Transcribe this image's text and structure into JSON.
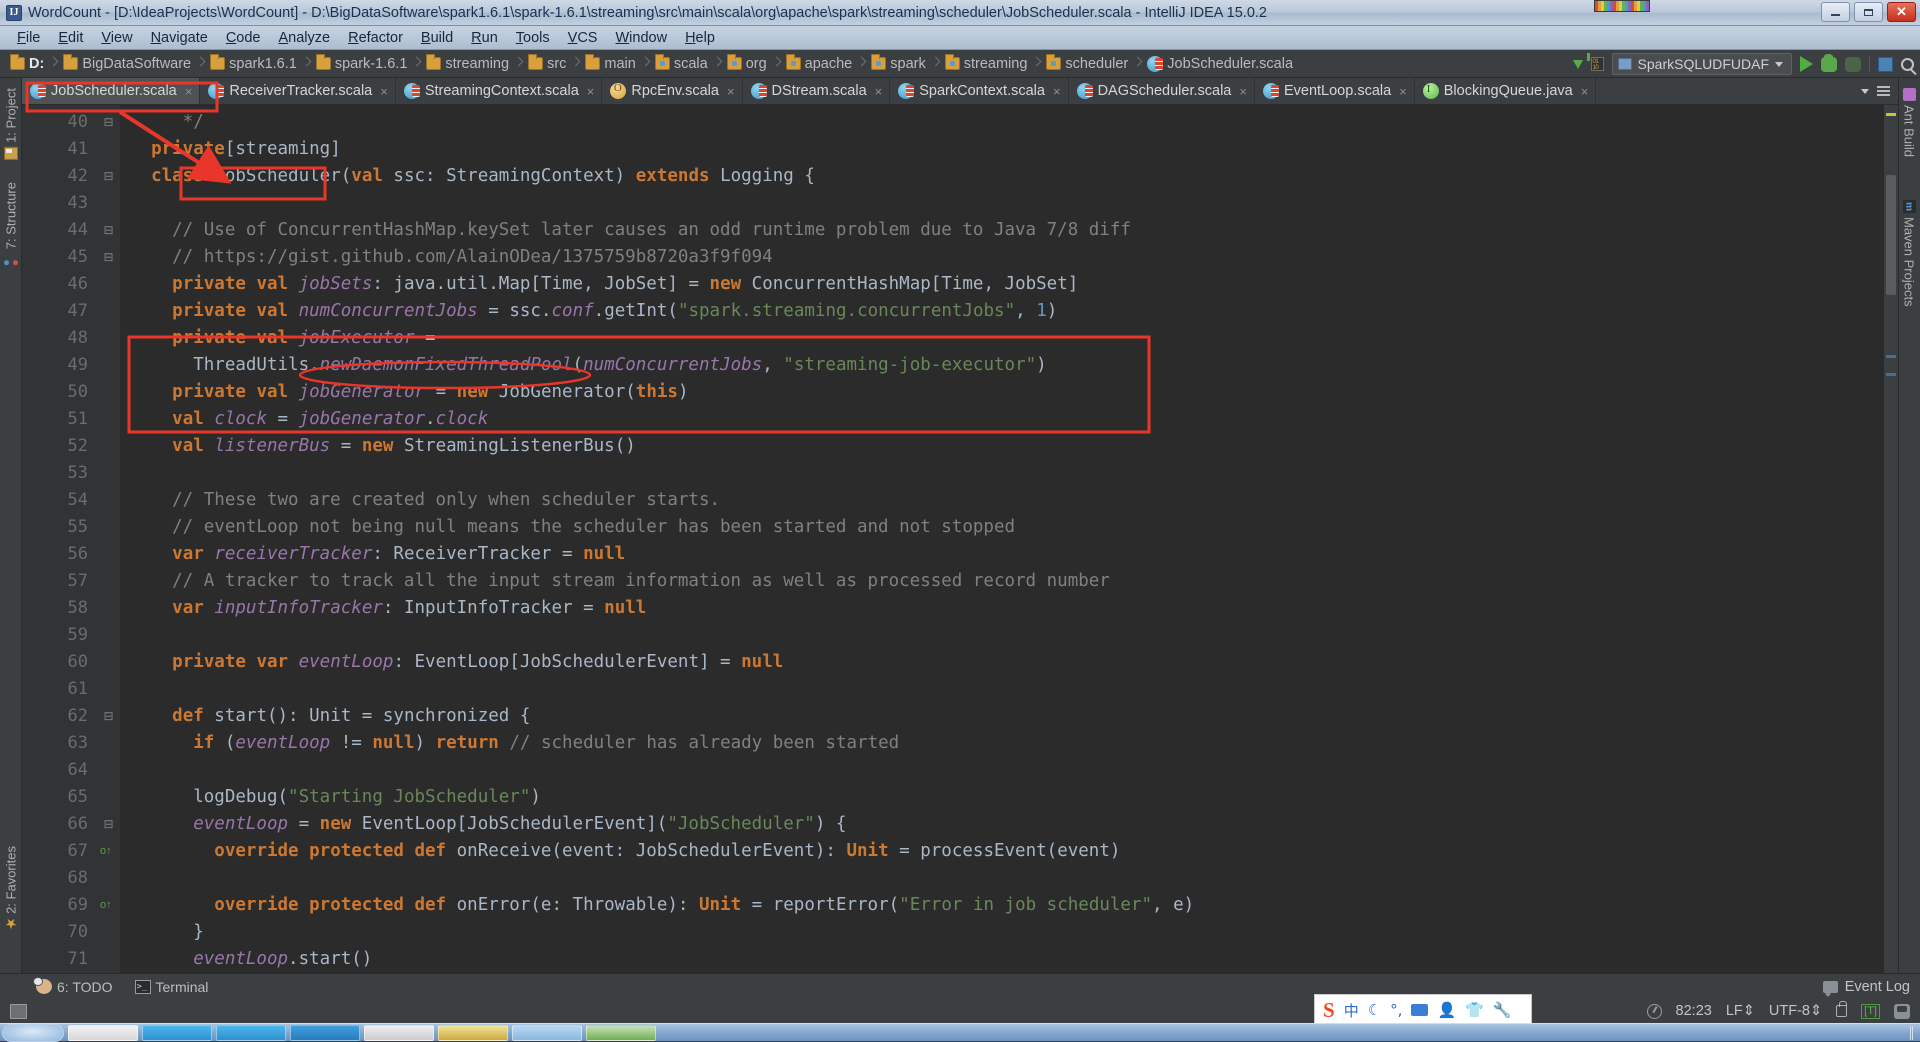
{
  "window": {
    "title": "WordCount - [D:\\IdeaProjects\\WordCount] - D:\\BigDataSoftware\\spark1.6.1\\spark-1.6.1\\streaming\\src\\main\\scala\\org\\apache\\spark\\streaming\\scheduler\\JobScheduler.scala - IntelliJ IDEA 15.0.2",
    "app_icon": "intellij-idea-icon",
    "minimize_label": "–",
    "maximize_label": "□",
    "close_label": "✕"
  },
  "menubar": {
    "items": [
      {
        "label": "File"
      },
      {
        "label": "Edit"
      },
      {
        "label": "View"
      },
      {
        "label": "Navigate"
      },
      {
        "label": "Code"
      },
      {
        "label": "Analyze"
      },
      {
        "label": "Refactor"
      },
      {
        "label": "Build"
      },
      {
        "label": "Run"
      },
      {
        "label": "Tools"
      },
      {
        "label": "VCS"
      },
      {
        "label": "Window"
      },
      {
        "label": "Help"
      }
    ]
  },
  "breadcrumb": {
    "items": [
      {
        "label": "D:",
        "icon": "folder-icon"
      },
      {
        "label": "BigDataSoftware",
        "icon": "folder-icon"
      },
      {
        "label": "spark1.6.1",
        "icon": "folder-icon"
      },
      {
        "label": "spark-1.6.1",
        "icon": "folder-icon"
      },
      {
        "label": "streaming",
        "icon": "folder-icon"
      },
      {
        "label": "src",
        "icon": "folder-icon"
      },
      {
        "label": "main",
        "icon": "folder-icon"
      },
      {
        "label": "scala",
        "icon": "source-folder-icon"
      },
      {
        "label": "org",
        "icon": "source-folder-icon"
      },
      {
        "label": "apache",
        "icon": "source-folder-icon"
      },
      {
        "label": "spark",
        "icon": "source-folder-icon"
      },
      {
        "label": "streaming",
        "icon": "source-folder-icon"
      },
      {
        "label": "scheduler",
        "icon": "source-folder-icon"
      },
      {
        "label": "JobScheduler.scala",
        "icon": "scala-file-icon"
      }
    ]
  },
  "toolbar": {
    "update_label": "update-project-icon",
    "run_config": "SparkSQLUDFUDAF",
    "run_label": "run-icon",
    "debug_label": "debug-icon",
    "coverage_label": "run-with-coverage-icon",
    "layout_label": "toggle-layout-icon",
    "search_label": "search-everywhere-icon"
  },
  "editor_tabs": {
    "close_glyph": "×",
    "items": [
      {
        "label": "JobScheduler.scala",
        "icon": "scala-file-icon",
        "active": true,
        "highlighted": true
      },
      {
        "label": "ReceiverTracker.scala",
        "icon": "scala-file-icon",
        "active": false,
        "highlighted": false
      },
      {
        "label": "StreamingContext.scala",
        "icon": "scala-file-icon",
        "active": false,
        "highlighted": false
      },
      {
        "label": "RpcEnv.scala",
        "icon": "scala-object-icon",
        "active": false,
        "highlighted": false
      },
      {
        "label": "DStream.scala",
        "icon": "scala-file-icon",
        "active": false,
        "highlighted": false
      },
      {
        "label": "SparkContext.scala",
        "icon": "scala-file-icon",
        "active": false,
        "highlighted": false
      },
      {
        "label": "DAGScheduler.scala",
        "icon": "scala-file-icon",
        "active": false,
        "highlighted": false
      },
      {
        "label": "EventLoop.scala",
        "icon": "scala-file-icon",
        "active": false,
        "highlighted": false
      },
      {
        "label": "BlockingQueue.java",
        "icon": "java-interface-icon",
        "active": false,
        "highlighted": false
      }
    ]
  },
  "left_tool_strip": {
    "items": [
      {
        "label": "1: Project",
        "icon": "project-icon"
      },
      {
        "label": "7: Structure",
        "icon": "structure-icon"
      },
      {
        "label": "2: Favorites",
        "icon": "star-icon"
      }
    ]
  },
  "right_tool_strip": {
    "items": [
      {
        "label": "Ant Build",
        "icon": "ant-icon"
      },
      {
        "label": "Maven Projects",
        "icon": "maven-icon"
      }
    ]
  },
  "code": {
    "first_line_number": 40,
    "lines": [
      {
        "n": 40,
        "fold": "⊟",
        "tokens": [
          {
            "t": "     */",
            "c": "cm"
          }
        ]
      },
      {
        "n": 41,
        "fold": "",
        "tokens": [
          {
            "t": "  ",
            "c": "pln"
          },
          {
            "t": "private",
            "c": "kw"
          },
          {
            "t": "[streaming]",
            "c": "pln"
          }
        ]
      },
      {
        "n": 42,
        "fold": "⊟",
        "tokens": [
          {
            "t": "  ",
            "c": "pln"
          },
          {
            "t": "class",
            "c": "kw"
          },
          {
            "t": " JobScheduler(",
            "c": "pln"
          },
          {
            "t": "val",
            "c": "kw"
          },
          {
            "t": " ssc: StreamingContext) ",
            "c": "pln"
          },
          {
            "t": "extends",
            "c": "kw"
          },
          {
            "t": " Logging {",
            "c": "pln"
          }
        ]
      },
      {
        "n": 43,
        "fold": "",
        "tokens": [
          {
            "t": "",
            "c": "pln"
          }
        ]
      },
      {
        "n": 44,
        "fold": "⊟",
        "tokens": [
          {
            "t": "    // Use of ConcurrentHashMap.keySet later causes an odd runtime problem due to Java 7/8 diff",
            "c": "cm"
          }
        ]
      },
      {
        "n": 45,
        "fold": "⊟",
        "tokens": [
          {
            "t": "    // https://gist.github.com/AlainODea/1375759b8720a3f9f094",
            "c": "cm"
          }
        ]
      },
      {
        "n": 46,
        "fold": "",
        "tokens": [
          {
            "t": "    ",
            "c": "pln"
          },
          {
            "t": "private val",
            "c": "kw"
          },
          {
            "t": " ",
            "c": "pln"
          },
          {
            "t": "jobSets",
            "c": "fld"
          },
          {
            "t": ": java.util.Map[Time, JobSet] = ",
            "c": "pln"
          },
          {
            "t": "new",
            "c": "kw"
          },
          {
            "t": " ConcurrentHashMap[Time, JobSet]",
            "c": "pln"
          }
        ]
      },
      {
        "n": 47,
        "fold": "",
        "tokens": [
          {
            "t": "    ",
            "c": "pln"
          },
          {
            "t": "private val",
            "c": "kw"
          },
          {
            "t": " ",
            "c": "pln"
          },
          {
            "t": "numConcurrentJobs",
            "c": "fld"
          },
          {
            "t": " = ssc.",
            "c": "pln"
          },
          {
            "t": "conf",
            "c": "fld"
          },
          {
            "t": ".getInt(",
            "c": "pln"
          },
          {
            "t": "\"spark.streaming.concurrentJobs\"",
            "c": "st"
          },
          {
            "t": ", ",
            "c": "pln"
          },
          {
            "t": "1",
            "c": "num"
          },
          {
            "t": ")",
            "c": "pln"
          }
        ]
      },
      {
        "n": 48,
        "fold": "",
        "tokens": [
          {
            "t": "    ",
            "c": "pln"
          },
          {
            "t": "private val",
            "c": "kw"
          },
          {
            "t": " ",
            "c": "pln"
          },
          {
            "t": "jobExecutor",
            "c": "fld"
          },
          {
            "t": " =",
            "c": "pln"
          }
        ]
      },
      {
        "n": 49,
        "fold": "",
        "tokens": [
          {
            "t": "      ThreadUtils.",
            "c": "pln"
          },
          {
            "t": "newDaemonFixedThreadPool",
            "c": "fld"
          },
          {
            "t": "(",
            "c": "pln"
          },
          {
            "t": "numConcurrentJobs",
            "c": "fld"
          },
          {
            "t": ", ",
            "c": "pln"
          },
          {
            "t": "\"streaming-job-executor\"",
            "c": "st"
          },
          {
            "t": ")",
            "c": "pln"
          }
        ]
      },
      {
        "n": 50,
        "fold": "",
        "tokens": [
          {
            "t": "    ",
            "c": "pln"
          },
          {
            "t": "private val",
            "c": "kw"
          },
          {
            "t": " ",
            "c": "pln"
          },
          {
            "t": "jobGenerator",
            "c": "fld"
          },
          {
            "t": " = ",
            "c": "pln"
          },
          {
            "t": "new",
            "c": "kw"
          },
          {
            "t": " JobGenerator(",
            "c": "pln"
          },
          {
            "t": "this",
            "c": "kw"
          },
          {
            "t": ")",
            "c": "pln"
          }
        ]
      },
      {
        "n": 51,
        "fold": "",
        "tokens": [
          {
            "t": "    ",
            "c": "pln"
          },
          {
            "t": "val",
            "c": "kw"
          },
          {
            "t": " ",
            "c": "pln"
          },
          {
            "t": "clock",
            "c": "fld"
          },
          {
            "t": " = ",
            "c": "pln"
          },
          {
            "t": "jobGenerator",
            "c": "fld"
          },
          {
            "t": ".",
            "c": "pln"
          },
          {
            "t": "clock",
            "c": "fld"
          }
        ]
      },
      {
        "n": 52,
        "fold": "",
        "tokens": [
          {
            "t": "    ",
            "c": "pln"
          },
          {
            "t": "val",
            "c": "kw"
          },
          {
            "t": " ",
            "c": "pln"
          },
          {
            "t": "listenerBus",
            "c": "fld"
          },
          {
            "t": " = ",
            "c": "pln"
          },
          {
            "t": "new",
            "c": "kw"
          },
          {
            "t": " StreamingListenerBus()",
            "c": "pln"
          }
        ]
      },
      {
        "n": 53,
        "fold": "",
        "tokens": [
          {
            "t": "",
            "c": "pln"
          }
        ]
      },
      {
        "n": 54,
        "fold": "",
        "tokens": [
          {
            "t": "    // These two are created only when scheduler starts.",
            "c": "cm"
          }
        ]
      },
      {
        "n": 55,
        "fold": "",
        "tokens": [
          {
            "t": "    // eventLoop not being null means the scheduler has been started and not stopped",
            "c": "cm"
          }
        ]
      },
      {
        "n": 56,
        "fold": "",
        "tokens": [
          {
            "t": "    ",
            "c": "pln"
          },
          {
            "t": "var",
            "c": "kw"
          },
          {
            "t": " ",
            "c": "pln"
          },
          {
            "t": "receiverTracker",
            "c": "fld"
          },
          {
            "t": ": ReceiverTracker = ",
            "c": "pln"
          },
          {
            "t": "null",
            "c": "kw"
          }
        ]
      },
      {
        "n": 57,
        "fold": "",
        "tokens": [
          {
            "t": "    // A tracker to track all the input stream information as well as processed record number",
            "c": "cm"
          }
        ]
      },
      {
        "n": 58,
        "fold": "",
        "tokens": [
          {
            "t": "    ",
            "c": "pln"
          },
          {
            "t": "var",
            "c": "kw"
          },
          {
            "t": " ",
            "c": "pln"
          },
          {
            "t": "inputInfoTracker",
            "c": "fld"
          },
          {
            "t": ": InputInfoTracker = ",
            "c": "pln"
          },
          {
            "t": "null",
            "c": "kw"
          }
        ]
      },
      {
        "n": 59,
        "fold": "",
        "tokens": [
          {
            "t": "",
            "c": "pln"
          }
        ]
      },
      {
        "n": 60,
        "fold": "",
        "tokens": [
          {
            "t": "    ",
            "c": "pln"
          },
          {
            "t": "private var",
            "c": "kw"
          },
          {
            "t": " ",
            "c": "pln"
          },
          {
            "t": "eventLoop",
            "c": "fld"
          },
          {
            "t": ": EventLoop[JobSchedulerEvent] = ",
            "c": "pln"
          },
          {
            "t": "null",
            "c": "kw"
          }
        ]
      },
      {
        "n": 61,
        "fold": "",
        "tokens": [
          {
            "t": "",
            "c": "pln"
          }
        ]
      },
      {
        "n": 62,
        "fold": "⊟",
        "tokens": [
          {
            "t": "    ",
            "c": "pln"
          },
          {
            "t": "def",
            "c": "kw"
          },
          {
            "t": " start(): Unit = synchronized {",
            "c": "pln"
          }
        ]
      },
      {
        "n": 63,
        "fold": "",
        "tokens": [
          {
            "t": "      ",
            "c": "pln"
          },
          {
            "t": "if",
            "c": "kw"
          },
          {
            "t": " (",
            "c": "pln"
          },
          {
            "t": "eventLoop",
            "c": "fld"
          },
          {
            "t": " != ",
            "c": "pln"
          },
          {
            "t": "null",
            "c": "kw"
          },
          {
            "t": ") ",
            "c": "pln"
          },
          {
            "t": "return",
            "c": "kw"
          },
          {
            "t": " // scheduler has already been started",
            "c": "cm"
          }
        ]
      },
      {
        "n": 64,
        "fold": "",
        "tokens": [
          {
            "t": "",
            "c": "pln"
          }
        ]
      },
      {
        "n": 65,
        "fold": "",
        "tokens": [
          {
            "t": "      logDebug(",
            "c": "pln"
          },
          {
            "t": "\"Starting JobScheduler\"",
            "c": "st"
          },
          {
            "t": ")",
            "c": "pln"
          }
        ]
      },
      {
        "n": 66,
        "fold": "⊟",
        "tokens": [
          {
            "t": "      ",
            "c": "pln"
          },
          {
            "t": "eventLoop",
            "c": "fld"
          },
          {
            "t": " = ",
            "c": "pln"
          },
          {
            "t": "new",
            "c": "kw"
          },
          {
            "t": " EventLoop[JobSchedulerEvent](",
            "c": "pln"
          },
          {
            "t": "\"JobScheduler\"",
            "c": "st"
          },
          {
            "t": ") {",
            "c": "pln"
          }
        ]
      },
      {
        "n": 67,
        "fold": "",
        "gutter": "override-icon",
        "tokens": [
          {
            "t": "        ",
            "c": "pln"
          },
          {
            "t": "override protected def",
            "c": "kw"
          },
          {
            "t": " onReceive(event: JobSchedulerEvent): ",
            "c": "pln"
          },
          {
            "t": "Unit",
            "c": "kw"
          },
          {
            "t": " = processEvent(event)",
            "c": "pln"
          }
        ]
      },
      {
        "n": 68,
        "fold": "",
        "tokens": [
          {
            "t": "",
            "c": "pln"
          }
        ]
      },
      {
        "n": 69,
        "fold": "",
        "gutter": "override-icon",
        "tokens": [
          {
            "t": "        ",
            "c": "pln"
          },
          {
            "t": "override protected def",
            "c": "kw"
          },
          {
            "t": " onError(e: ",
            "c": "pln"
          },
          {
            "t": "Throwable",
            "c": "typ"
          },
          {
            "t": "): ",
            "c": "pln"
          },
          {
            "t": "Unit",
            "c": "kw"
          },
          {
            "t": " = reportError(",
            "c": "pln"
          },
          {
            "t": "\"Error in job scheduler\"",
            "c": "st"
          },
          {
            "t": ", e)",
            "c": "pln"
          }
        ]
      },
      {
        "n": 70,
        "fold": "",
        "tokens": [
          {
            "t": "      }",
            "c": "pln"
          }
        ]
      },
      {
        "n": 71,
        "fold": "",
        "tokens": [
          {
            "t": "      ",
            "c": "pln"
          },
          {
            "t": "eventLoop",
            "c": "fld"
          },
          {
            "t": ".start()",
            "c": "pln"
          }
        ]
      }
    ]
  },
  "annotations": {
    "class_name_box": "JobScheduler",
    "job_executor_box": "private val jobExecutor / ThreadUtils.newDaemonFixedThreadPool / private val jobGenerator",
    "thread_pool_ellipse": "newDaemonFixedThreadPool",
    "tab_box": "JobScheduler.scala",
    "arrow": "pointer-arrow"
  },
  "bottom_tool_bar": {
    "items": [
      {
        "label": "6: TODO",
        "icon": "todo-icon"
      },
      {
        "label": "Terminal",
        "icon": "terminal-icon"
      }
    ],
    "event_log": "Event Log"
  },
  "statusbar": {
    "caret_position": "82:23",
    "line_separator": "LF",
    "encoding": "UTF-8",
    "lock_icon": "read-only-lock-icon",
    "tab_icon": "[T]",
    "gauge_icon": "memory-gauge-icon",
    "inspector_icon": "inspection-profile-icon"
  },
  "ime_bar": {
    "logo": "S",
    "mode": "中",
    "moon": "☾",
    "punct": "°,",
    "keyboard": "keyboard-icon",
    "user": "user-icon",
    "shirt": "skin-icon",
    "wrench": "settings-icon"
  },
  "colors": {
    "editor_bg": "#2b2b2b",
    "gutter_bg": "#313335",
    "chrome_bg": "#3c3f41",
    "keyword": "#cc7832",
    "string": "#6a8759",
    "comment": "#808080",
    "field": "#9876aa",
    "number": "#6897bb",
    "annotation_red": "#e8372a",
    "titlebar_blue": "#b9c7da"
  }
}
